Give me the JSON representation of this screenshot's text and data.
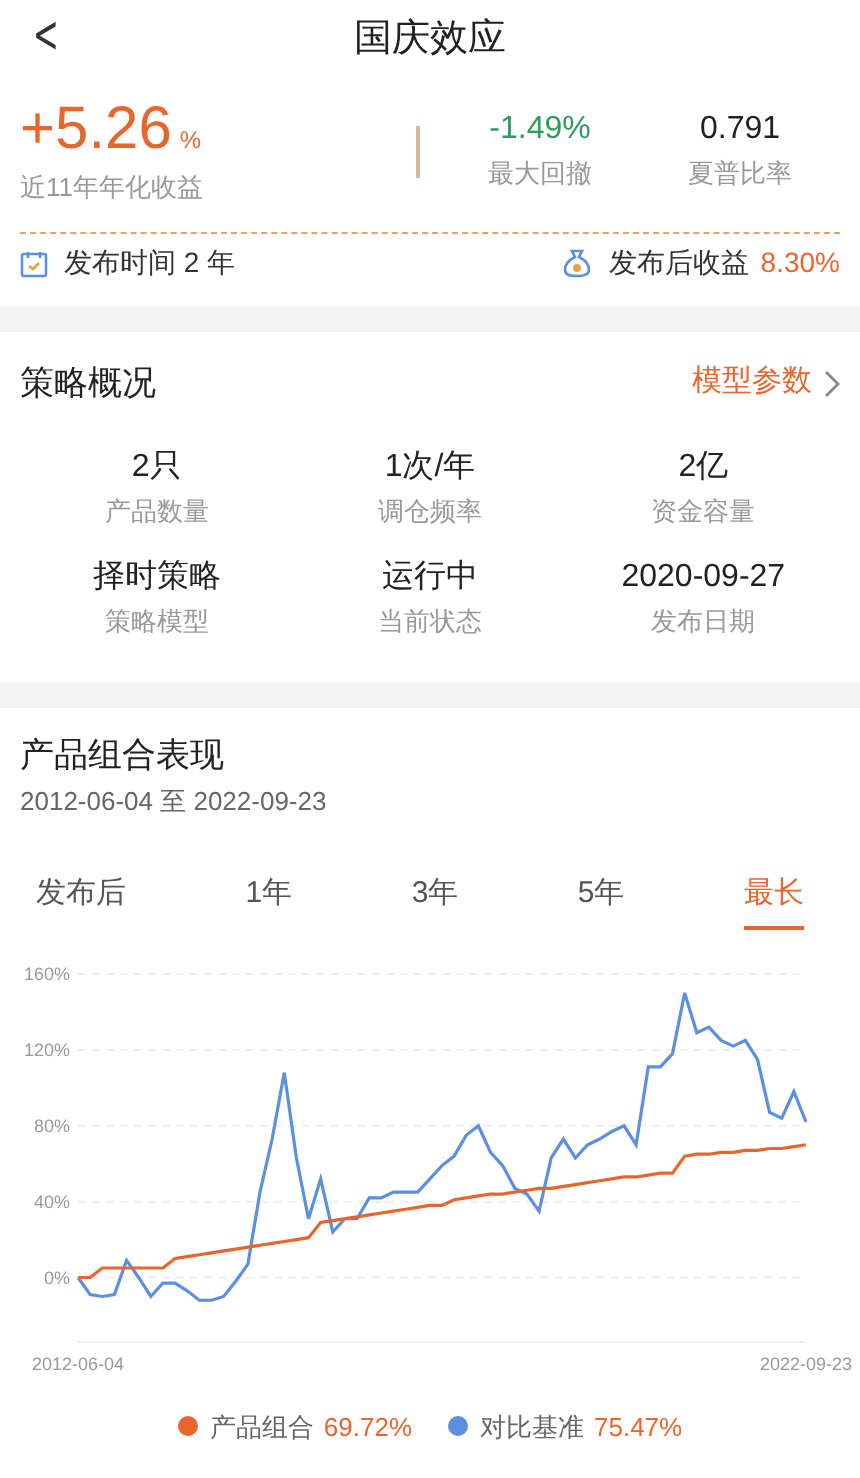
{
  "header": {
    "back": "<",
    "title": "国庆效应"
  },
  "summary": {
    "annual_return": {
      "value": "+5.26",
      "unit": "%",
      "label": "近11年年化收益"
    },
    "metrics": [
      {
        "value": "-1.49%",
        "label": "最大回撤",
        "kind": "down"
      },
      {
        "value": "0.791",
        "label": "夏普比率",
        "kind": "plain"
      }
    ],
    "publish_time": "发布时间 2 年",
    "since_label": "发布后收益",
    "since_value": "8.30%"
  },
  "strategy": {
    "title": "策略概况",
    "link": "模型参数",
    "items": [
      {
        "value": "2只",
        "label": "产品数量"
      },
      {
        "value": "1次/年",
        "label": "调仓频率"
      },
      {
        "value": "2亿",
        "label": "资金容量"
      },
      {
        "value": "择时策略",
        "label": "策略模型"
      },
      {
        "value": "运行中",
        "label": "当前状态"
      },
      {
        "value": "2020-09-27",
        "label": "发布日期"
      }
    ]
  },
  "performance": {
    "title": "产品组合表现",
    "range": "2012-06-04 至 2022-09-23",
    "tabs": [
      {
        "label": "发布后",
        "selected": false
      },
      {
        "label": "1年",
        "selected": false
      },
      {
        "label": "3年",
        "selected": false
      },
      {
        "label": "5年",
        "selected": false
      },
      {
        "label": "最长",
        "selected": true
      }
    ],
    "chart_data": {
      "type": "line",
      "categories": [
        "2012-06-04",
        null,
        null,
        null,
        null,
        null,
        null,
        null,
        null,
        null,
        null,
        null,
        null,
        null,
        null,
        null,
        null,
        null,
        null,
        null,
        null,
        null,
        null,
        null,
        null,
        null,
        null,
        null,
        null,
        null,
        null,
        null,
        null,
        null,
        null,
        null,
        null,
        null,
        null,
        null,
        null,
        null,
        null,
        null,
        null,
        null,
        null,
        null,
        null,
        null,
        null,
        null,
        null,
        null,
        null,
        null,
        null,
        null,
        null,
        null,
        "2022-09-23"
      ],
      "grid": true,
      "yticks": [
        {
          "value": 0,
          "label": "0%"
        },
        {
          "value": 40,
          "label": "40%"
        },
        {
          "value": 80,
          "label": "80%"
        },
        {
          "value": 120,
          "label": "120%"
        },
        {
          "value": 160,
          "label": "160%"
        }
      ],
      "ylim": [
        -34,
        160
      ],
      "series": [
        {
          "name": "产品组合",
          "color": "#e8662e",
          "values": [
            0,
            0,
            5,
            5,
            5,
            5,
            5,
            5,
            10,
            11,
            12,
            13,
            14,
            15,
            16,
            17,
            18,
            19,
            20,
            21,
            29,
            30,
            31,
            32,
            33,
            34,
            35,
            36,
            37,
            38,
            38,
            41,
            42,
            43,
            44,
            44,
            45,
            46,
            47,
            47,
            48,
            49,
            50,
            51,
            52,
            53,
            53,
            54,
            55,
            55,
            64,
            65,
            65,
            66,
            66,
            67,
            67,
            68,
            68,
            69,
            70
          ]
        },
        {
          "name": "对比基准",
          "color": "#5b8fe0",
          "values": [
            0,
            -9,
            -10,
            -9,
            9,
            0,
            -10,
            -3,
            -3,
            -7,
            -12,
            -12,
            -10,
            -2,
            7,
            45,
            73,
            108,
            63,
            31,
            52,
            24,
            31,
            31,
            42,
            42,
            45,
            45,
            45,
            52,
            59,
            64,
            75,
            80,
            66,
            59,
            47,
            44,
            35,
            63,
            73,
            63,
            70,
            73,
            77,
            80,
            70,
            111,
            111,
            118,
            150,
            129,
            132,
            125,
            122,
            125,
            115,
            87,
            84,
            98,
            82
          ]
        }
      ]
    },
    "legend_values": [
      "69.72%",
      "75.47%"
    ]
  }
}
